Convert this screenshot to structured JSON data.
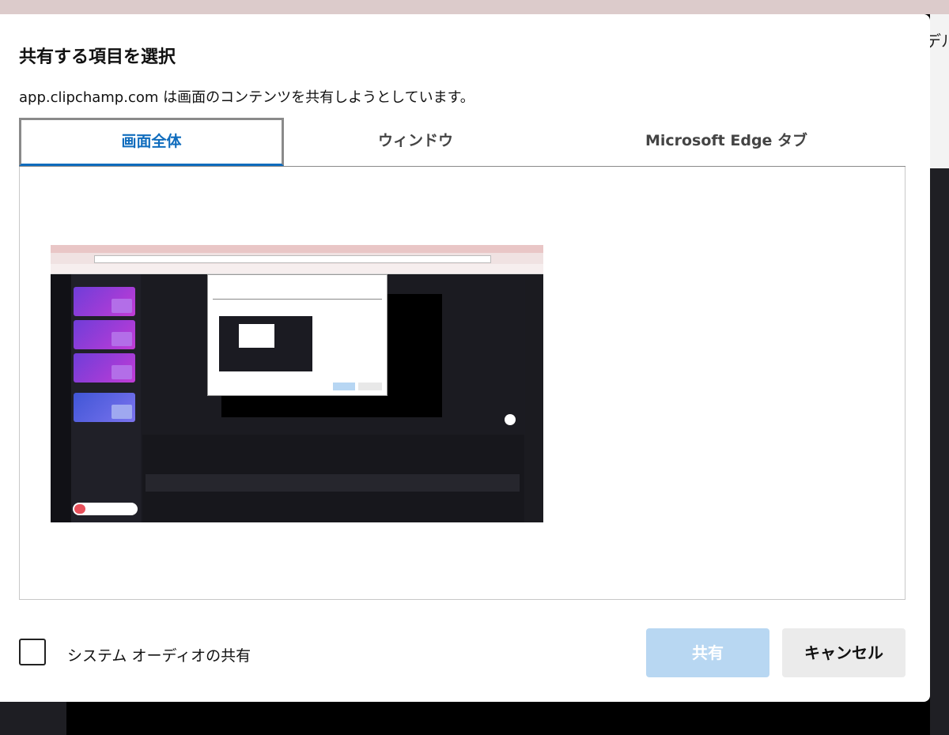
{
  "background": {
    "right_partial_text": "デル"
  },
  "dialog": {
    "title": "共有する項目を選択",
    "subtitle": "app.clipchamp.com は画面のコンテンツを共有しようとしています。",
    "tabs": [
      {
        "label": "画面全体",
        "active": true
      },
      {
        "label": "ウィンドウ",
        "active": false
      },
      {
        "label": "Microsoft Edge タブ",
        "active": false
      }
    ],
    "system_audio": {
      "label": "システム オーディオの共有",
      "checked": false
    },
    "share_button": "共有",
    "cancel_button": "キャンセル"
  },
  "colors": {
    "accent": "#0f6cbd",
    "share_disabled": "#b8d7f2",
    "cancel_bg": "#ebebeb"
  }
}
